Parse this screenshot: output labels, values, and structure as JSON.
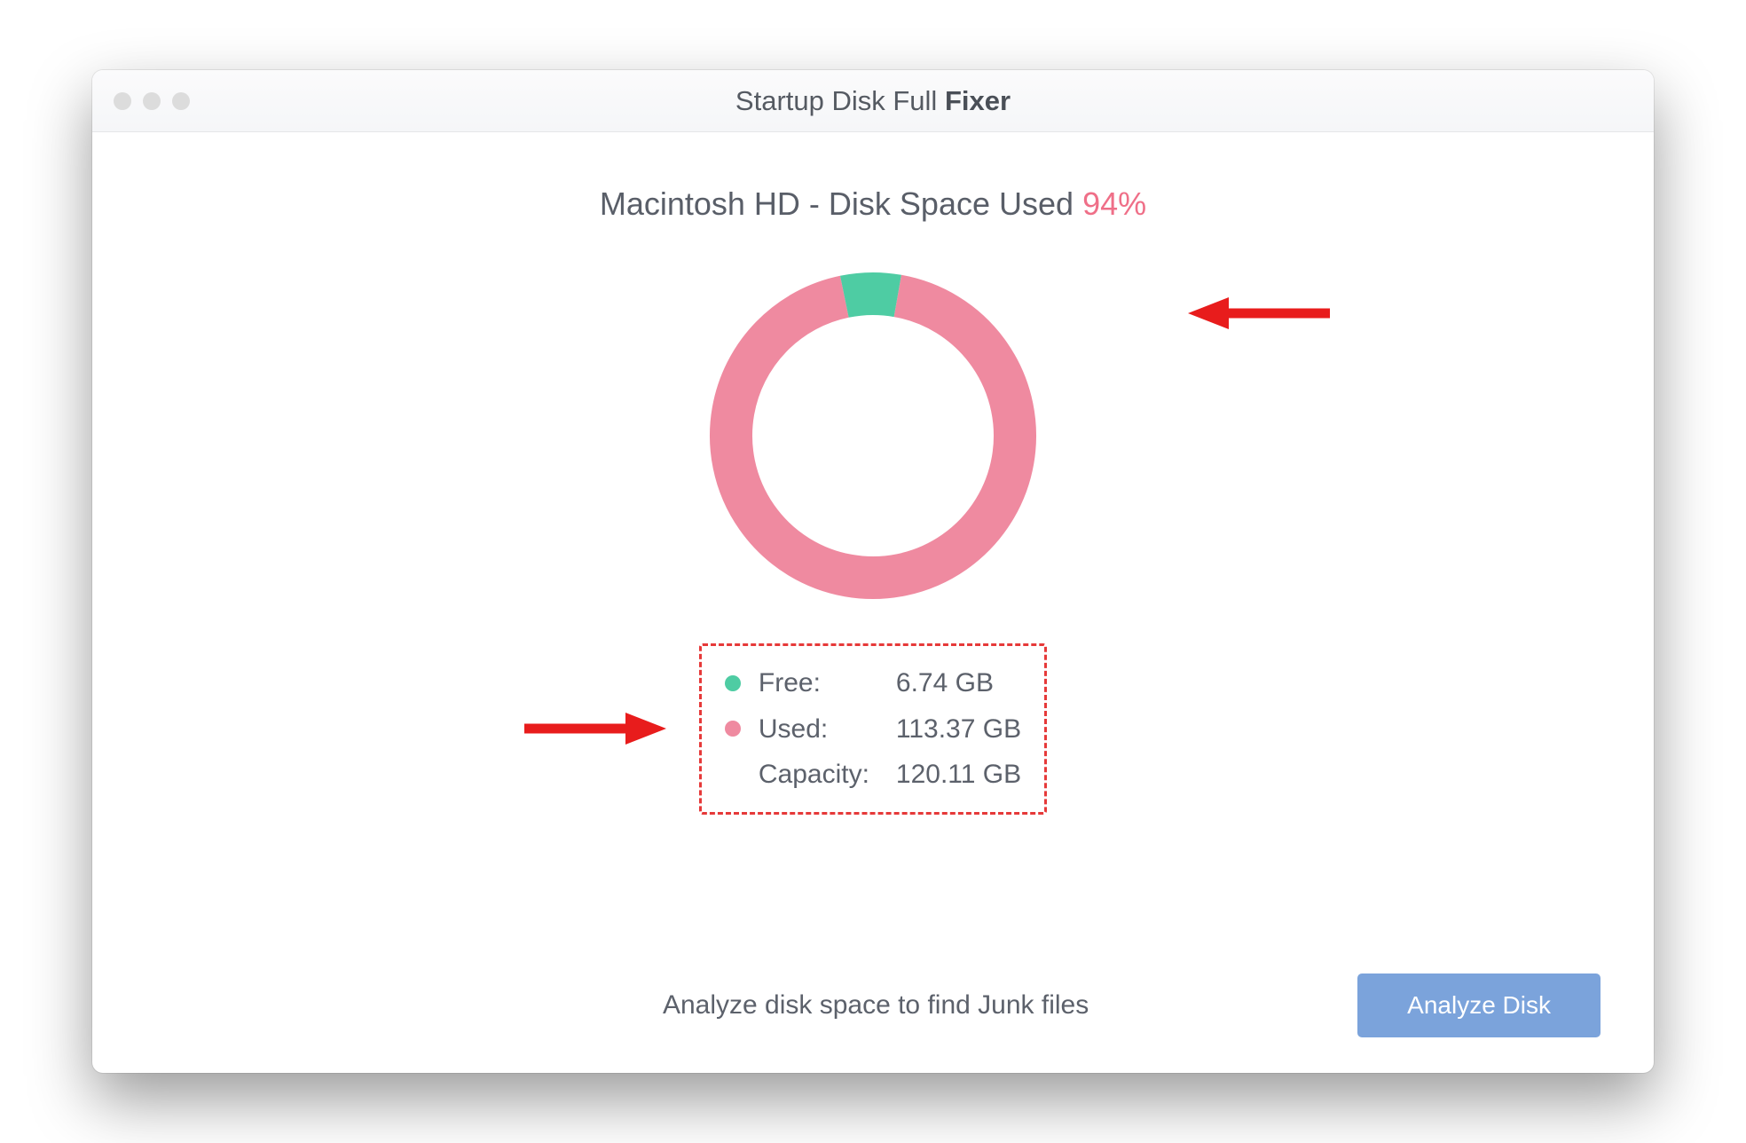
{
  "titlebar": {
    "title_light": "Startup Disk Full",
    "title_bold": "Fixer"
  },
  "heading": {
    "prefix": "Macintosh HD - Disk Space Used",
    "percent": "94%"
  },
  "legend": {
    "free_label": "Free:",
    "free_value": "6.74 GB",
    "used_label": "Used:",
    "used_value": "113.37 GB",
    "capacity_label": "Capacity:",
    "capacity_value": "120.11 GB"
  },
  "footer": {
    "text": "Analyze disk space to find Junk files",
    "button": "Analyze Disk"
  },
  "colors": {
    "used": "#ef8aa0",
    "free": "#4ecca3",
    "accent": "#7ba3db",
    "highlight": "#e63939"
  },
  "chart_data": {
    "type": "pie",
    "title": "Macintosh HD - Disk Space Used 94%",
    "series": [
      {
        "name": "Used",
        "value": 113.37,
        "unit": "GB",
        "percent": 94,
        "color": "#ef8aa0"
      },
      {
        "name": "Free",
        "value": 6.74,
        "unit": "GB",
        "percent": 6,
        "color": "#4ecca3"
      }
    ],
    "total": {
      "name": "Capacity",
      "value": 120.11,
      "unit": "GB"
    }
  }
}
